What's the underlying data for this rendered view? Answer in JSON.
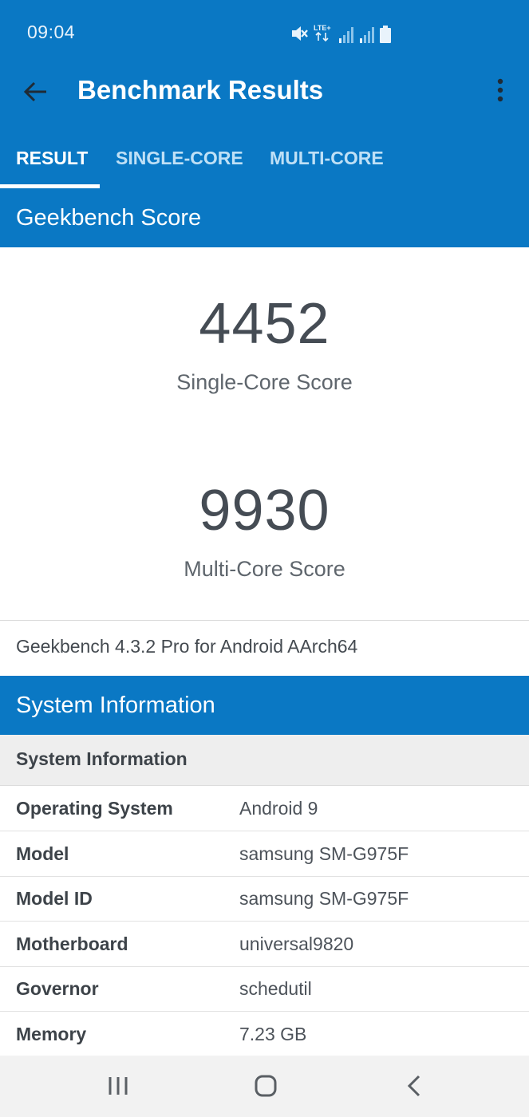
{
  "status_bar": {
    "time": "09:04",
    "network_label": "LTE+",
    "icons": [
      "mute-icon",
      "lte-plus-icon",
      "signal-icon",
      "signal-icon",
      "battery-icon"
    ]
  },
  "toolbar": {
    "title": "Benchmark Results",
    "back_icon": "arrow-left-icon",
    "menu_icon": "overflow-menu-icon"
  },
  "tabs": [
    {
      "label": "RESULT",
      "active": true
    },
    {
      "label": "SINGLE-CORE",
      "active": false
    },
    {
      "label": "MULTI-CORE",
      "active": false
    }
  ],
  "geekbench_section": {
    "title": "Geekbench Score"
  },
  "scores": {
    "single": {
      "value": "4452",
      "label": "Single-Core Score"
    },
    "multi": {
      "value": "9930",
      "label": "Multi-Core Score"
    }
  },
  "version": "Geekbench 4.3.2 Pro for Android AArch64",
  "system_section": {
    "title": "System Information",
    "subheader": "System Information",
    "rows": [
      {
        "key": "Operating System",
        "value": "Android 9"
      },
      {
        "key": "Model",
        "value": "samsung SM-G975F"
      },
      {
        "key": "Model ID",
        "value": "samsung SM-G975F"
      },
      {
        "key": "Motherboard",
        "value": "universal9820"
      },
      {
        "key": "Governor",
        "value": "schedutil"
      },
      {
        "key": "Memory",
        "value": "7.23 GB"
      }
    ]
  },
  "nav_bar": {
    "icons": [
      "recent-apps-icon",
      "home-icon",
      "back-icon"
    ]
  },
  "colors": {
    "primary": "#0a78c4",
    "tab_inactive": "#bfe0f6",
    "score_text": "#454c54",
    "subheader_bg": "#eeeeee",
    "nav_bg": "#f2f2f2"
  }
}
